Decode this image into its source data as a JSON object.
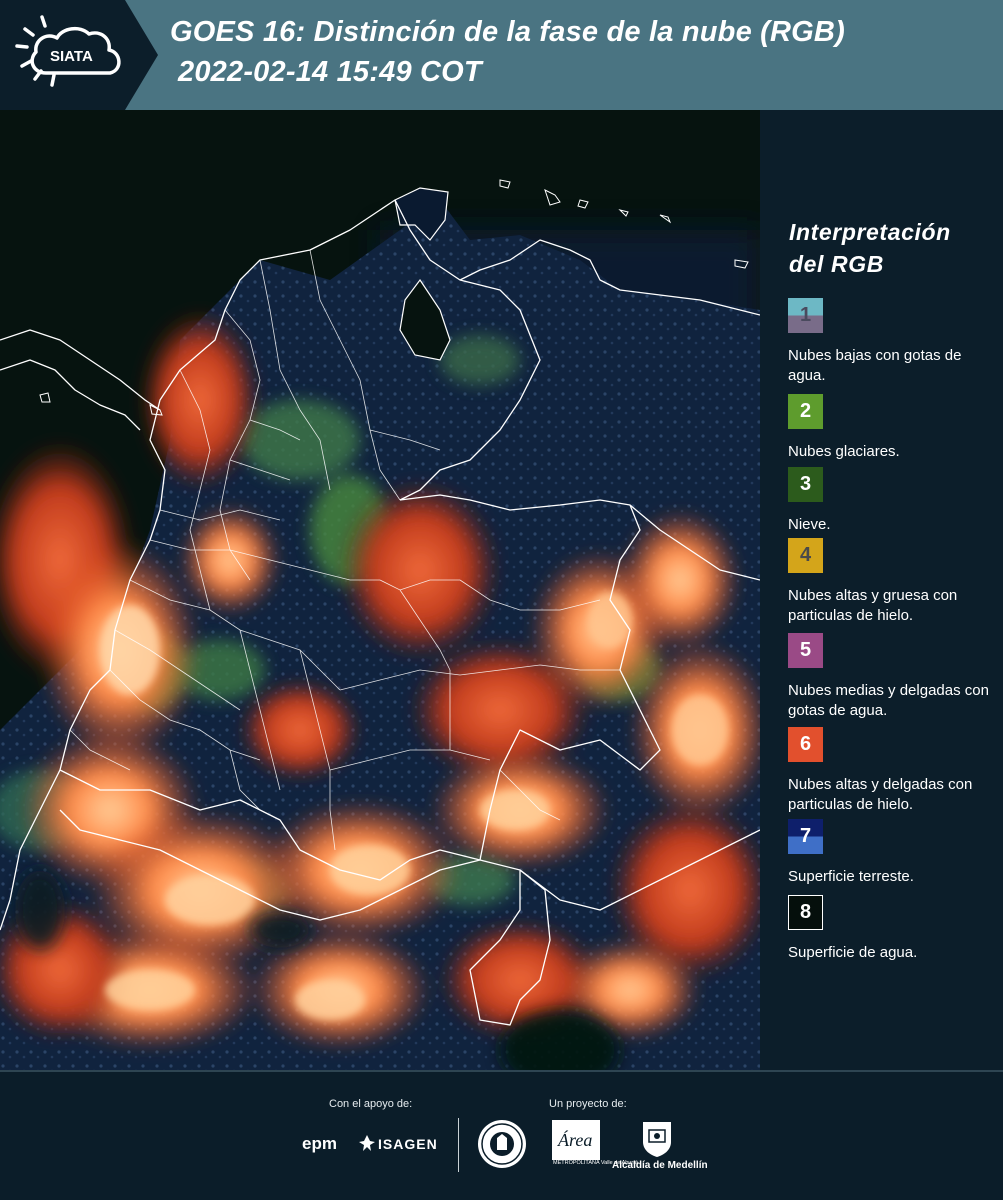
{
  "header": {
    "logo_text": "SIATA",
    "title_line1": "GOES 16: Distinción de la fase de la nube (RGB)",
    "title_line2": "2022-02-14 15:49 COT",
    "background_color": "#4a7482",
    "logo_panel_color": "#0c1e2a"
  },
  "legend": {
    "title": "Interpretación del RGB",
    "items": [
      {
        "number": "1",
        "label": "Nubes bajas con gotas de agua.",
        "color_top": "#6db8c5",
        "color_bottom": "#796c89",
        "number_color": "#4a4a5e"
      },
      {
        "number": "2",
        "label": "Nubes glaciares.",
        "color": "#5e9c2d",
        "number_color": "#ffffff"
      },
      {
        "number": "3",
        "label": "Nieve.",
        "color": "#2c5b1c",
        "number_color": "#ffffff"
      },
      {
        "number": "4",
        "label": "Nubes altas y gruesa con particulas de hielo.",
        "color": "#d4a51a",
        "number_color": "#4a4a4a"
      },
      {
        "number": "5",
        "label": "Nubes medias y delgadas con gotas de agua.",
        "color": "#9a4a86",
        "number_color": "#ffffff"
      },
      {
        "number": "6",
        "label": "Nubes altas y delgadas con particulas de hielo.",
        "color": "#e2502d",
        "number_color": "#ffffff"
      },
      {
        "number": "7",
        "label": "Superficie terreste.",
        "color_top": "#0e1f6b",
        "color_bottom": "#3f6fc7",
        "number_color": "#ffffff"
      },
      {
        "number": "8",
        "label": "Superficie de agua.",
        "color": "#050f0c",
        "number_color": "#ffffff",
        "border": "#ffffff"
      }
    ]
  },
  "footer": {
    "support_label": "Con el apoyo de:",
    "project_label": "Un proyecto de:",
    "sponsor_1": "epm",
    "sponsor_2": "ISAGEN",
    "partner_1_text": "Área",
    "partner_1_sub": "METROPOLITANA Valle de Aburrá",
    "partner_2": "Alcaldía de Medellín"
  }
}
